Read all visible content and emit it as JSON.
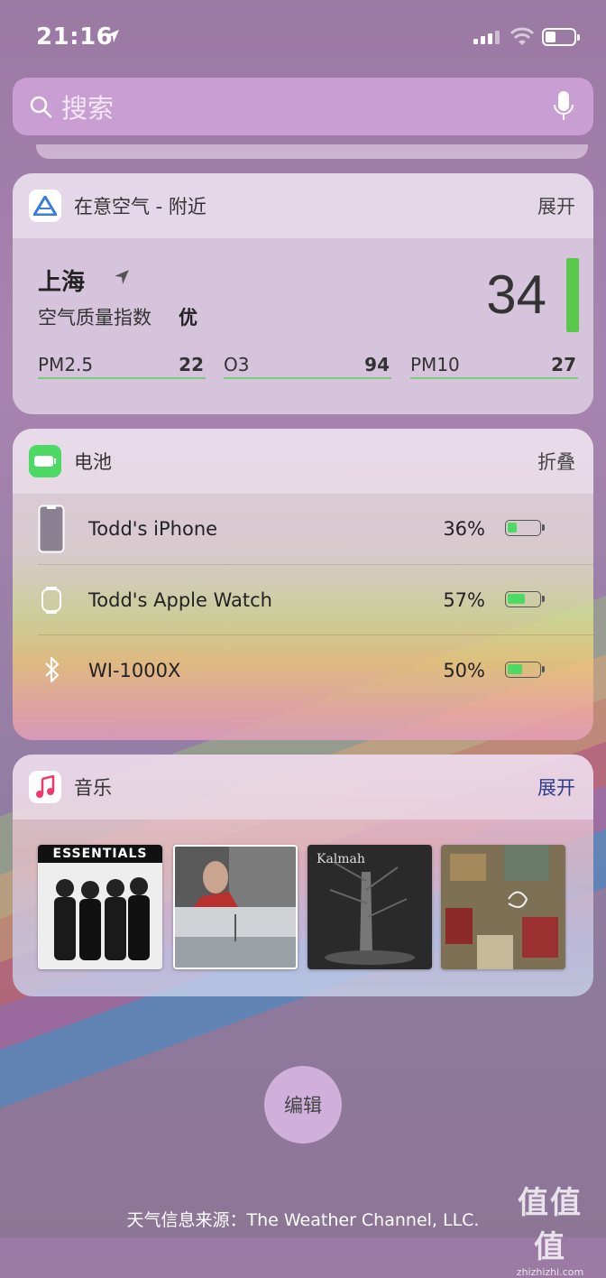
{
  "status_bar": {
    "time": "21:16"
  },
  "search": {
    "placeholder": "搜索"
  },
  "air_widget": {
    "title": "在意空气 - 附近",
    "action": "展开",
    "city": "上海",
    "aqi_label": "空气质量指数",
    "aqi_level": "优",
    "aqi_value": "34",
    "indicators": [
      {
        "name": "PM2.5",
        "value": "22"
      },
      {
        "name": "O3",
        "value": "94"
      },
      {
        "name": "PM10",
        "value": "27"
      }
    ],
    "accent_color": "#59c84c"
  },
  "battery_widget": {
    "title": "电池",
    "action": "折叠",
    "devices": [
      {
        "name": "Todd's iPhone",
        "percent": "36%",
        "level": 0.36,
        "icon": "iphone-icon"
      },
      {
        "name": "Todd's Apple Watch",
        "percent": "57%",
        "level": 0.57,
        "icon": "watch-icon"
      },
      {
        "name": "WI-1000X",
        "percent": "50%",
        "level": 0.5,
        "icon": "bluetooth-icon"
      }
    ]
  },
  "music_widget": {
    "title": "音乐",
    "action": "展开",
    "albums": [
      {
        "title_text": "ESSENTIALS"
      },
      {
        "title_text": ""
      },
      {
        "title_text": "Kalmah"
      },
      {
        "title_text": ""
      }
    ]
  },
  "edit_button": {
    "label": "编辑"
  },
  "footer": {
    "text": "天气信息来源：The Weather Channel, LLC."
  },
  "watermark": {
    "big": "值值值",
    "small": "zhizhizhi.com"
  }
}
